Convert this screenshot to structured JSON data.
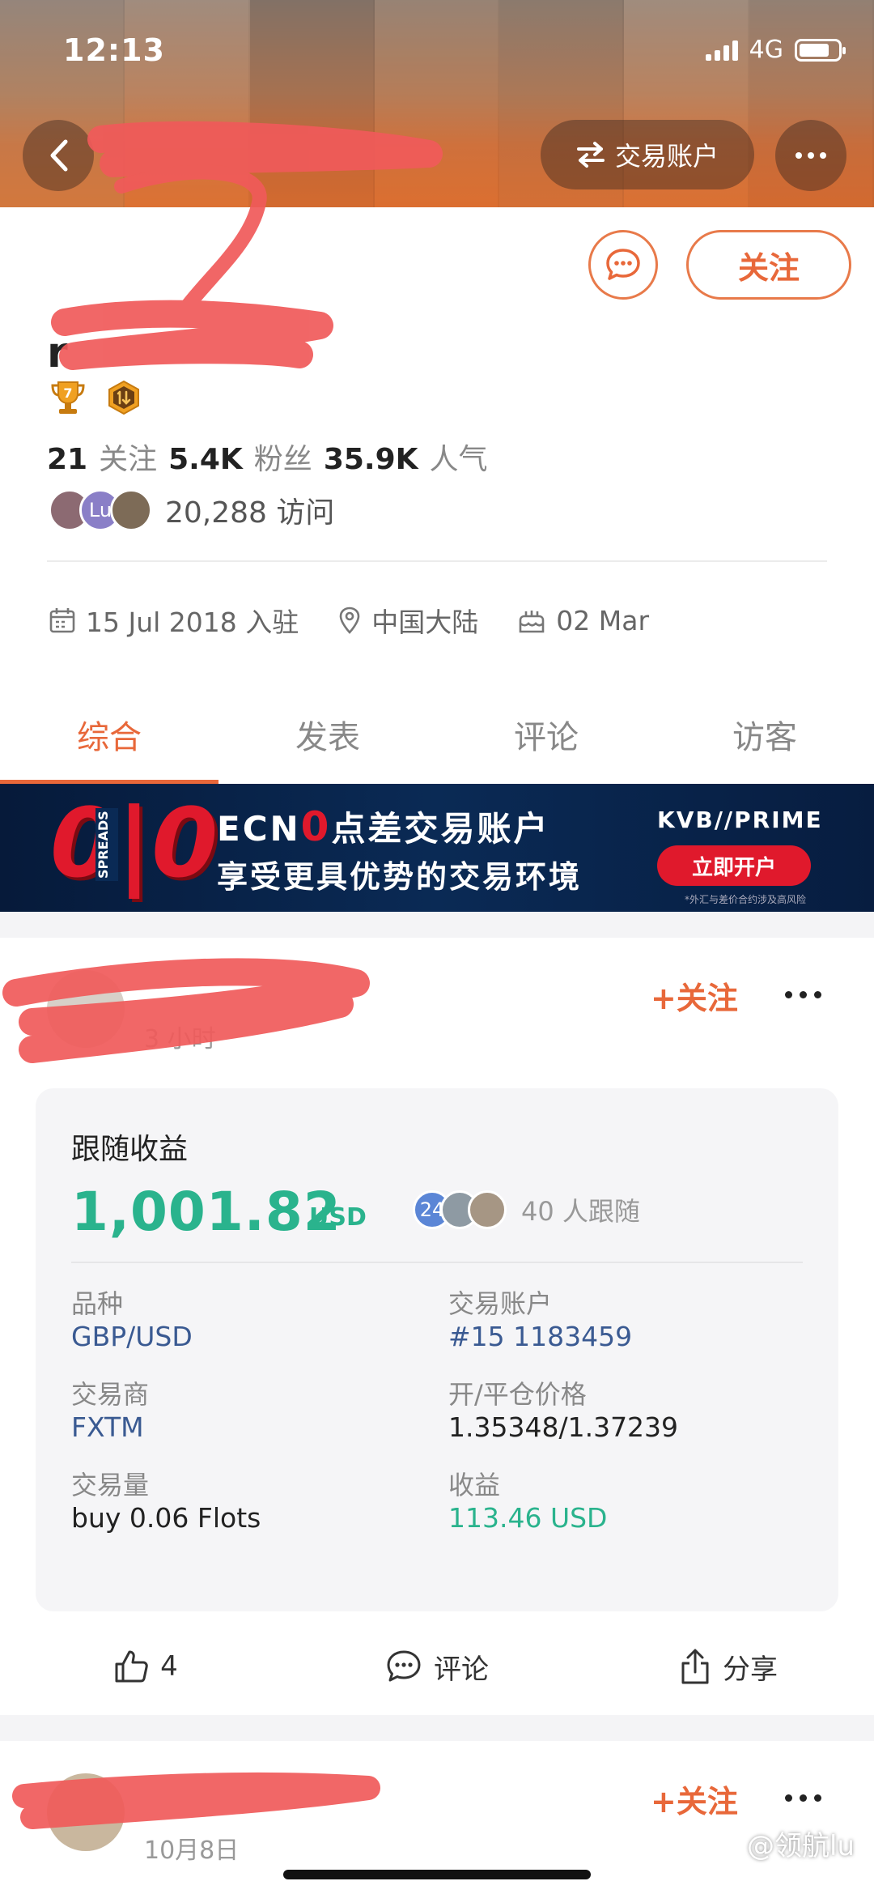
{
  "status_bar": {
    "time": "12:13",
    "network": "4G"
  },
  "header": {
    "switch_account_label": "交易账户"
  },
  "profile": {
    "name_visible": "r",
    "follow_label": "关注",
    "level_badge": "7",
    "stats": {
      "following_count": "21",
      "following_label": "关注",
      "fans_count": "5.4K",
      "fans_label": "粉丝",
      "popularity_count": "35.9K",
      "popularity_label": "人气"
    },
    "visitor_avatar_text": "Lu",
    "visits": "20,288 访问",
    "joined": "15 Jul 2018 入驻",
    "location": "中国大陆",
    "birthday": "02 Mar"
  },
  "tabs": [
    {
      "label": "综合",
      "active": true
    },
    {
      "label": "发表",
      "active": false
    },
    {
      "label": "评论",
      "active": false
    },
    {
      "label": "访客",
      "active": false
    }
  ],
  "banner": {
    "big_digits": "0|0",
    "spreads": "SPREADS",
    "line1_prefix": "ECN",
    "line1_zero": "0",
    "line1_suffix": "点差交易账户",
    "line2": "享受更具优势的交易环境",
    "brand": "KVB//PRIME",
    "cta": "立即开户",
    "fine_print": "*外汇与差价合约涉及高风险"
  },
  "post": {
    "follow_label": "+关注",
    "time_partial": "3 小时",
    "profit_title": "跟随收益",
    "profit_amount": "1,001.82",
    "profit_unit": "USD",
    "followers_badge": "24",
    "followers_text": "40 人跟随",
    "details": [
      {
        "label": "品种",
        "value": "GBP/USD",
        "style": "link"
      },
      {
        "label": "交易账户",
        "value": "#15 1183459",
        "style": "link"
      },
      {
        "label": "交易商",
        "value": "FXTM",
        "style": "link"
      },
      {
        "label": "开/平仓价格",
        "value": "1.35348/1.37239",
        "style": "plain"
      },
      {
        "label": "交易量",
        "value": "buy 0.06 Flots",
        "style": "plain"
      },
      {
        "label": "收益",
        "value": "113.46 USD",
        "style": "green"
      }
    ],
    "likes": "4",
    "comment_label": "评论",
    "share_label": "分享"
  },
  "post2": {
    "follow_label": "+关注",
    "date": "10月8日"
  },
  "watermark": "@领航lu",
  "colors": {
    "accent": "#e8683a",
    "green": "#2ab38d",
    "link": "#3a5a92",
    "banner_red": "#e0192c"
  }
}
